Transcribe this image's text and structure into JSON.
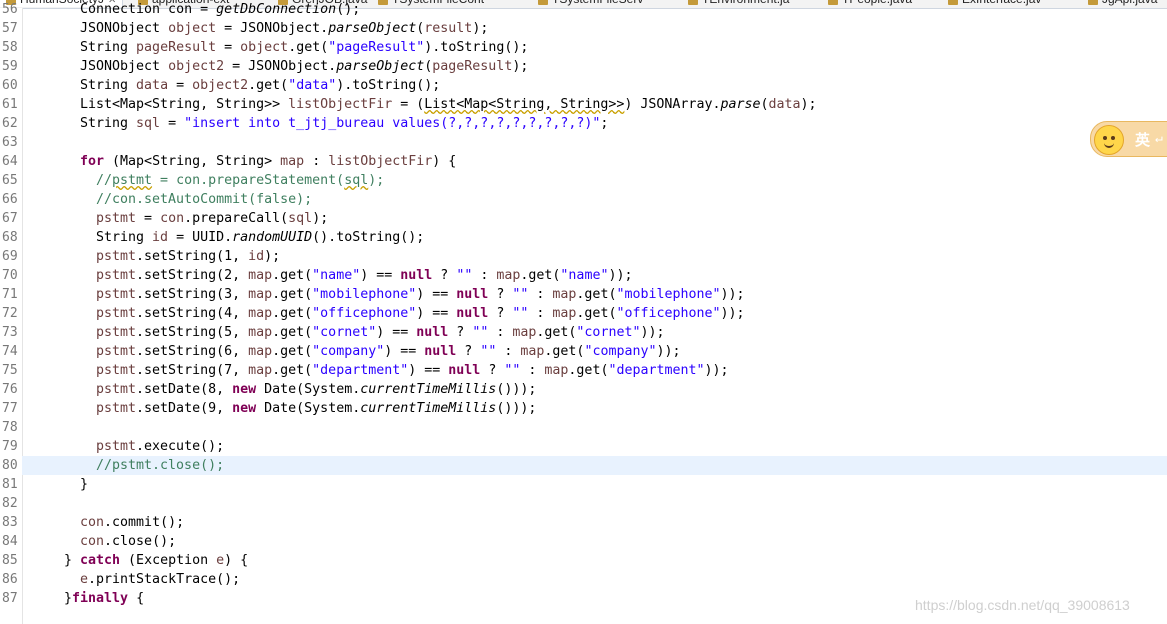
{
  "tabs": [
    {
      "label": "HumanSocietyJ",
      "active": true
    },
    {
      "label": "application-ext",
      "active": false
    },
    {
      "label": "GrehJOB.java",
      "active": false
    },
    {
      "label": "TSystemFileCont",
      "active": false
    },
    {
      "label": "TSystemFileServ",
      "active": false
    },
    {
      "label": "TEnvironment.ja",
      "active": false
    },
    {
      "label": "TPeople.java",
      "active": false
    },
    {
      "label": "ExInterface.jav",
      "active": false
    },
    {
      "label": "JgApi.java",
      "active": false
    }
  ],
  "current_line": 80,
  "lines": [
    {
      "n": "56",
      "indent": 6,
      "t": [
        {
          "s": "Connection con = "
        },
        {
          "s": "getDbConnection",
          "c": "ital"
        },
        {
          "s": "();"
        }
      ]
    },
    {
      "n": "57",
      "indent": 6,
      "t": [
        {
          "s": "JSONObject "
        },
        {
          "s": "object",
          "c": "var"
        },
        {
          "s": " = JSONObject."
        },
        {
          "s": "parseObject",
          "c": "ital"
        },
        {
          "s": "("
        },
        {
          "s": "result",
          "c": "var"
        },
        {
          "s": ");"
        }
      ]
    },
    {
      "n": "58",
      "indent": 6,
      "t": [
        {
          "s": "String "
        },
        {
          "s": "pageResult",
          "c": "var"
        },
        {
          "s": " = "
        },
        {
          "s": "object",
          "c": "var"
        },
        {
          "s": ".get("
        },
        {
          "s": "\"pageResult\"",
          "c": "str"
        },
        {
          "s": ").toString();"
        }
      ]
    },
    {
      "n": "59",
      "indent": 6,
      "t": [
        {
          "s": "JSONObject "
        },
        {
          "s": "object2",
          "c": "var"
        },
        {
          "s": " = JSONObject."
        },
        {
          "s": "parseObject",
          "c": "ital"
        },
        {
          "s": "("
        },
        {
          "s": "pageResult",
          "c": "var"
        },
        {
          "s": ");"
        }
      ]
    },
    {
      "n": "60",
      "indent": 6,
      "t": [
        {
          "s": "String "
        },
        {
          "s": "data",
          "c": "var"
        },
        {
          "s": " = "
        },
        {
          "s": "object2",
          "c": "var"
        },
        {
          "s": ".get("
        },
        {
          "s": "\"data\"",
          "c": "str"
        },
        {
          "s": ").toString();"
        }
      ]
    },
    {
      "n": "61",
      "indent": 6,
      "t": [
        {
          "s": "List<Map<String, String>> "
        },
        {
          "s": "listObjectFir",
          "c": "var"
        },
        {
          "s": " = ("
        },
        {
          "s": "List<Map<String, String>>",
          "c": "warn"
        },
        {
          "s": ") JSONArray."
        },
        {
          "s": "parse",
          "c": "ital"
        },
        {
          "s": "("
        },
        {
          "s": "data",
          "c": "var"
        },
        {
          "s": ");"
        }
      ]
    },
    {
      "n": "62",
      "indent": 6,
      "t": [
        {
          "s": "String "
        },
        {
          "s": "sql",
          "c": "var"
        },
        {
          "s": " = "
        },
        {
          "s": "\"insert into t_jtj_bureau values(?,?,?,?,?,?,?,?,?)\"",
          "c": "str"
        },
        {
          "s": ";"
        }
      ]
    },
    {
      "n": "63",
      "indent": 0,
      "t": []
    },
    {
      "n": "64",
      "indent": 6,
      "t": [
        {
          "s": "for",
          "c": "kw"
        },
        {
          "s": " (Map<String, String> "
        },
        {
          "s": "map",
          "c": "var"
        },
        {
          "s": " : "
        },
        {
          "s": "listObjectFir",
          "c": "var"
        },
        {
          "s": ") {"
        }
      ]
    },
    {
      "n": "65",
      "indent": 8,
      "t": [
        {
          "s": "//",
          "c": "cmt"
        },
        {
          "s": "pstmt",
          "c": "cmt warn"
        },
        {
          "s": " = con.prepareStatement(",
          "c": "cmt"
        },
        {
          "s": "sql",
          "c": "cmt warn"
        },
        {
          "s": ");",
          "c": "cmt"
        }
      ]
    },
    {
      "n": "66",
      "indent": 8,
      "t": [
        {
          "s": "//con.setAutoCommit(false);",
          "c": "cmt"
        }
      ]
    },
    {
      "n": "67",
      "indent": 8,
      "t": [
        {
          "s": "pstmt",
          "c": "var"
        },
        {
          "s": " = "
        },
        {
          "s": "con",
          "c": "var"
        },
        {
          "s": ".prepareCall("
        },
        {
          "s": "sql",
          "c": "var"
        },
        {
          "s": ");"
        }
      ]
    },
    {
      "n": "68",
      "indent": 8,
      "t": [
        {
          "s": "String "
        },
        {
          "s": "id",
          "c": "var"
        },
        {
          "s": " = UUID."
        },
        {
          "s": "randomUUID",
          "c": "ital"
        },
        {
          "s": "().toString();"
        }
      ]
    },
    {
      "n": "69",
      "indent": 8,
      "t": [
        {
          "s": "pstmt",
          "c": "var"
        },
        {
          "s": ".setString(1, "
        },
        {
          "s": "id",
          "c": "var"
        },
        {
          "s": ");"
        }
      ]
    },
    {
      "n": "70",
      "indent": 8,
      "t": [
        {
          "s": "pstmt",
          "c": "var"
        },
        {
          "s": ".setString(2, "
        },
        {
          "s": "map",
          "c": "var"
        },
        {
          "s": ".get("
        },
        {
          "s": "\"name\"",
          "c": "str"
        },
        {
          "s": ") == "
        },
        {
          "s": "null",
          "c": "kw"
        },
        {
          "s": " ? "
        },
        {
          "s": "\"\"",
          "c": "str"
        },
        {
          "s": " : "
        },
        {
          "s": "map",
          "c": "var"
        },
        {
          "s": ".get("
        },
        {
          "s": "\"name\"",
          "c": "str"
        },
        {
          "s": "));"
        }
      ]
    },
    {
      "n": "71",
      "indent": 8,
      "t": [
        {
          "s": "pstmt",
          "c": "var"
        },
        {
          "s": ".setString(3, "
        },
        {
          "s": "map",
          "c": "var"
        },
        {
          "s": ".get("
        },
        {
          "s": "\"mobilephone\"",
          "c": "str"
        },
        {
          "s": ") == "
        },
        {
          "s": "null",
          "c": "kw"
        },
        {
          "s": " ? "
        },
        {
          "s": "\"\"",
          "c": "str"
        },
        {
          "s": " : "
        },
        {
          "s": "map",
          "c": "var"
        },
        {
          "s": ".get("
        },
        {
          "s": "\"mobilephone\"",
          "c": "str"
        },
        {
          "s": "));"
        }
      ]
    },
    {
      "n": "72",
      "indent": 8,
      "t": [
        {
          "s": "pstmt",
          "c": "var"
        },
        {
          "s": ".setString(4, "
        },
        {
          "s": "map",
          "c": "var"
        },
        {
          "s": ".get("
        },
        {
          "s": "\"officephone\"",
          "c": "str"
        },
        {
          "s": ") == "
        },
        {
          "s": "null",
          "c": "kw"
        },
        {
          "s": " ? "
        },
        {
          "s": "\"\"",
          "c": "str"
        },
        {
          "s": " : "
        },
        {
          "s": "map",
          "c": "var"
        },
        {
          "s": ".get("
        },
        {
          "s": "\"officephone\"",
          "c": "str"
        },
        {
          "s": "));"
        }
      ]
    },
    {
      "n": "73",
      "indent": 8,
      "t": [
        {
          "s": "pstmt",
          "c": "var"
        },
        {
          "s": ".setString(5, "
        },
        {
          "s": "map",
          "c": "var"
        },
        {
          "s": ".get("
        },
        {
          "s": "\"cornet\"",
          "c": "str"
        },
        {
          "s": ") == "
        },
        {
          "s": "null",
          "c": "kw"
        },
        {
          "s": " ? "
        },
        {
          "s": "\"\"",
          "c": "str"
        },
        {
          "s": " : "
        },
        {
          "s": "map",
          "c": "var"
        },
        {
          "s": ".get("
        },
        {
          "s": "\"cornet\"",
          "c": "str"
        },
        {
          "s": "));"
        }
      ]
    },
    {
      "n": "74",
      "indent": 8,
      "t": [
        {
          "s": "pstmt",
          "c": "var"
        },
        {
          "s": ".setString(6, "
        },
        {
          "s": "map",
          "c": "var"
        },
        {
          "s": ".get("
        },
        {
          "s": "\"company\"",
          "c": "str"
        },
        {
          "s": ") == "
        },
        {
          "s": "null",
          "c": "kw"
        },
        {
          "s": " ? "
        },
        {
          "s": "\"\"",
          "c": "str"
        },
        {
          "s": " : "
        },
        {
          "s": "map",
          "c": "var"
        },
        {
          "s": ".get("
        },
        {
          "s": "\"company\"",
          "c": "str"
        },
        {
          "s": "));"
        }
      ]
    },
    {
      "n": "75",
      "indent": 8,
      "t": [
        {
          "s": "pstmt",
          "c": "var"
        },
        {
          "s": ".setString(7, "
        },
        {
          "s": "map",
          "c": "var"
        },
        {
          "s": ".get("
        },
        {
          "s": "\"department\"",
          "c": "str"
        },
        {
          "s": ") == "
        },
        {
          "s": "null",
          "c": "kw"
        },
        {
          "s": " ? "
        },
        {
          "s": "\"\"",
          "c": "str"
        },
        {
          "s": " : "
        },
        {
          "s": "map",
          "c": "var"
        },
        {
          "s": ".get("
        },
        {
          "s": "\"department\"",
          "c": "str"
        },
        {
          "s": "));"
        }
      ]
    },
    {
      "n": "76",
      "indent": 8,
      "t": [
        {
          "s": "pstmt",
          "c": "var"
        },
        {
          "s": ".setDate(8, "
        },
        {
          "s": "new",
          "c": "kw"
        },
        {
          "s": " Date(System."
        },
        {
          "s": "currentTimeMillis",
          "c": "ital"
        },
        {
          "s": "()));"
        }
      ]
    },
    {
      "n": "77",
      "indent": 8,
      "t": [
        {
          "s": "pstmt",
          "c": "var"
        },
        {
          "s": ".setDate(9, "
        },
        {
          "s": "new",
          "c": "kw"
        },
        {
          "s": " Date(System."
        },
        {
          "s": "currentTimeMillis",
          "c": "ital"
        },
        {
          "s": "()));"
        }
      ]
    },
    {
      "n": "78",
      "indent": 0,
      "t": []
    },
    {
      "n": "79",
      "indent": 8,
      "t": [
        {
          "s": "pstmt",
          "c": "var"
        },
        {
          "s": ".execute();"
        }
      ]
    },
    {
      "n": "80",
      "indent": 8,
      "t": [
        {
          "s": "//pstmt.close();",
          "c": "cmt"
        }
      ]
    },
    {
      "n": "81",
      "indent": 6,
      "t": [
        {
          "s": "}"
        }
      ]
    },
    {
      "n": "82",
      "indent": 0,
      "t": []
    },
    {
      "n": "83",
      "indent": 6,
      "t": [
        {
          "s": "con",
          "c": "var"
        },
        {
          "s": ".commit();"
        }
      ]
    },
    {
      "n": "84",
      "indent": 6,
      "t": [
        {
          "s": "con",
          "c": "var"
        },
        {
          "s": ".close();"
        }
      ]
    },
    {
      "n": "85",
      "indent": 4,
      "t": [
        {
          "s": "} "
        },
        {
          "s": "catch",
          "c": "kw"
        },
        {
          "s": " (Exception "
        },
        {
          "s": "e",
          "c": "var"
        },
        {
          "s": ") {"
        }
      ]
    },
    {
      "n": "86",
      "indent": 6,
      "t": [
        {
          "s": "e",
          "c": "var"
        },
        {
          "s": ".printStackTrace();"
        }
      ]
    },
    {
      "n": "87",
      "indent": 4,
      "t": [
        {
          "s": "}"
        },
        {
          "s": "finally",
          "c": "kw"
        },
        {
          "s": " {"
        }
      ]
    }
  ],
  "ime": {
    "label": "英"
  },
  "watermark": "https://blog.csdn.net/qq_39008613",
  "colors": {
    "keyword": "#7f0055",
    "string": "#2a00ff",
    "comment": "#3f7f5f",
    "local_variable": "#6a3e3e",
    "line_number": "#787878",
    "current_line_highlight": "#e8f2fe",
    "ime_background": "#f8d9a6"
  }
}
